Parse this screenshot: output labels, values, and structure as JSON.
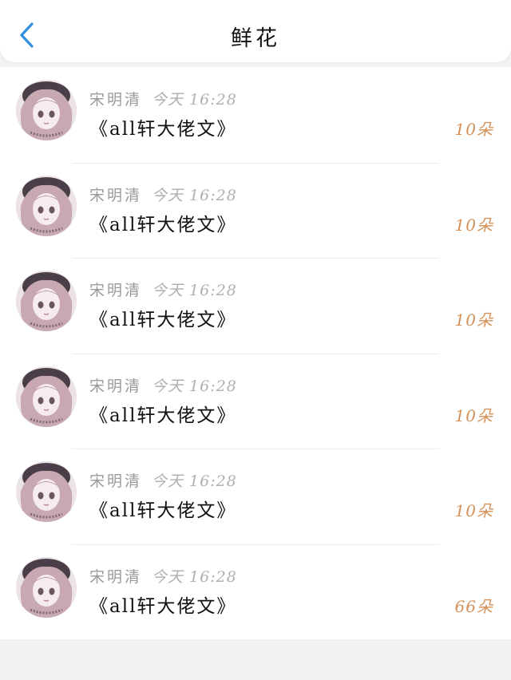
{
  "header": {
    "title": "鲜花",
    "back_icon": "chevron-left-icon",
    "accent_color": "#2f8fe0"
  },
  "list": {
    "items": [
      {
        "name": "宋明清",
        "time": "今天 16:28",
        "title": "《all轩大佬文》",
        "count": "10朵"
      },
      {
        "name": "宋明清",
        "time": "今天 16:28",
        "title": "《all轩大佬文》",
        "count": "10朵"
      },
      {
        "name": "宋明清",
        "time": "今天 16:28",
        "title": "《all轩大佬文》",
        "count": "10朵"
      },
      {
        "name": "宋明清",
        "time": "今天 16:28",
        "title": "《all轩大佬文》",
        "count": "10朵"
      },
      {
        "name": "宋明清",
        "time": "今天 16:28",
        "title": "《all轩大佬文》",
        "count": "10朵"
      },
      {
        "name": "宋明清",
        "time": "今天 16:28",
        "title": "《all轩大佬文》",
        "count": "66朵"
      }
    ]
  },
  "colors": {
    "count": "#d4925a",
    "meta": "#9a9a9a",
    "background": "#f2f2f4"
  }
}
